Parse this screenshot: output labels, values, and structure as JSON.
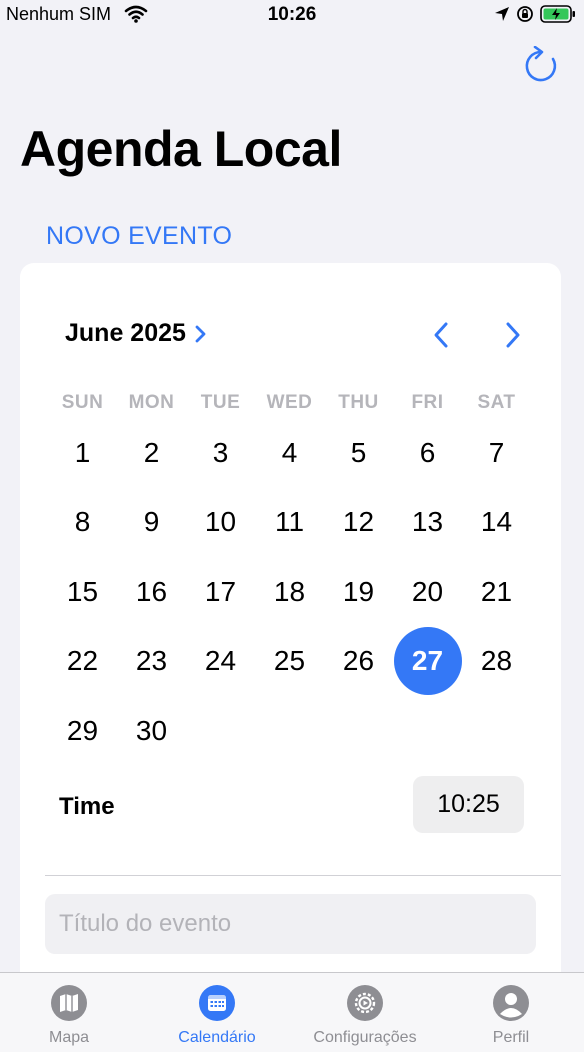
{
  "status_bar": {
    "carrier": "Nenhum SIM",
    "time": "10:26"
  },
  "header": {
    "title": "Agenda Local"
  },
  "section": {
    "header": "NOVO EVENTO"
  },
  "calendar": {
    "month_label": "June 2025",
    "weekdays": [
      "SUN",
      "MON",
      "TUE",
      "WED",
      "THU",
      "FRI",
      "SAT"
    ],
    "days": [
      "1",
      "2",
      "3",
      "4",
      "5",
      "6",
      "7",
      "8",
      "9",
      "10",
      "11",
      "12",
      "13",
      "14",
      "15",
      "16",
      "17",
      "18",
      "19",
      "20",
      "21",
      "22",
      "23",
      "24",
      "25",
      "26",
      "27",
      "28",
      "29",
      "30"
    ],
    "selected_day": "27",
    "accent_color": "#3478f6"
  },
  "time": {
    "label": "Time",
    "value": "10:25"
  },
  "form": {
    "title_placeholder": "Título do evento"
  },
  "tabs": [
    {
      "label": "Mapa",
      "icon": "map-icon"
    },
    {
      "label": "Calendário",
      "icon": "calendar-icon"
    },
    {
      "label": "Configurações",
      "icon": "gear-icon"
    },
    {
      "label": "Perfil",
      "icon": "person-icon"
    }
  ]
}
